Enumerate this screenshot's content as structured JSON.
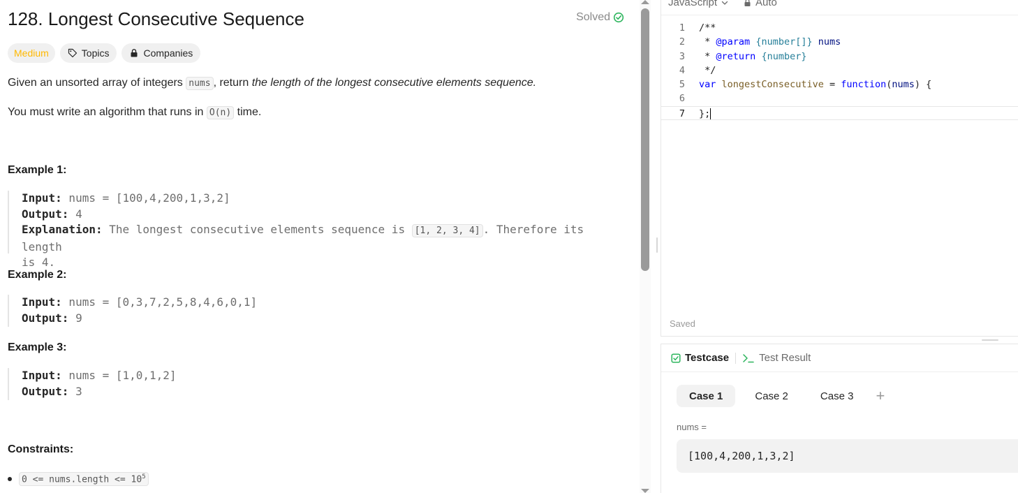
{
  "problem": {
    "title": "128. Longest Consecutive Sequence",
    "solved_label": "Solved",
    "tags": {
      "difficulty": "Medium",
      "topics": "Topics",
      "companies": "Companies"
    },
    "desc_p1_a": "Given an unsorted array of integers ",
    "desc_p1_code": "nums",
    "desc_p1_b": ", return ",
    "desc_p1_em": "the length of the longest consecutive elements sequence.",
    "desc_p2_a": "You must write an algorithm that runs in ",
    "desc_p2_code": "O(n)",
    "desc_p2_b": " time.",
    "examples": [
      {
        "heading": "Example 1:",
        "input_label": "Input:",
        "input": " nums = [100,4,200,1,3,2]",
        "output_label": "Output:",
        "output": " 4",
        "explanation_label": "Explanation:",
        "explanation_a": " The longest consecutive elements sequence is ",
        "explanation_code": "[1, 2, 3, 4]",
        "explanation_b": ". Therefore its length",
        "explanation_c": "is 4."
      },
      {
        "heading": "Example 2:",
        "input_label": "Input:",
        "input": " nums = [0,3,7,2,5,8,4,6,0,1]",
        "output_label": "Output:",
        "output": " 9"
      },
      {
        "heading": "Example 3:",
        "input_label": "Input:",
        "input": " nums = [1,0,1,2]",
        "output_label": "Output:",
        "output": " 3"
      }
    ],
    "constraints_heading": "Constraints:",
    "constraint_1_base": "0 <= nums.length <= 10",
    "constraint_1_sup": "5"
  },
  "editor": {
    "language": "JavaScript",
    "mode": "Auto",
    "line_numbers": [
      "1",
      "2",
      "3",
      "4",
      "5",
      "6",
      "7"
    ],
    "code": {
      "l1": "/**",
      "l2_a": " * ",
      "l2_tag": "@param",
      "l2_sp": " ",
      "l2_type": "{number[]}",
      "l2_name": " nums",
      "l3_a": " * ",
      "l3_tag": "@return",
      "l3_sp": " ",
      "l3_type": "{number}",
      "l4": " */",
      "l5_kw": "var",
      "l5_sp": " ",
      "l5_fn": "longestConsecutive",
      "l5_eq": " = ",
      "l5_kw2": "function",
      "l5_open": "(",
      "l5_param": "nums",
      "l5_close": ") {",
      "l6": "",
      "l7": "};"
    },
    "status": "Saved"
  },
  "testpanel": {
    "tabs": {
      "testcase": "Testcase",
      "result": "Test Result"
    },
    "cases": [
      "Case 1",
      "Case 2",
      "Case 3"
    ],
    "add_case": "+",
    "var_label": "nums =",
    "var_value": "[100,4,200,1,3,2]"
  },
  "colors": {
    "medium": "#ffb800",
    "solved": "#2db55d",
    "testcase_check": "#2db55d"
  }
}
